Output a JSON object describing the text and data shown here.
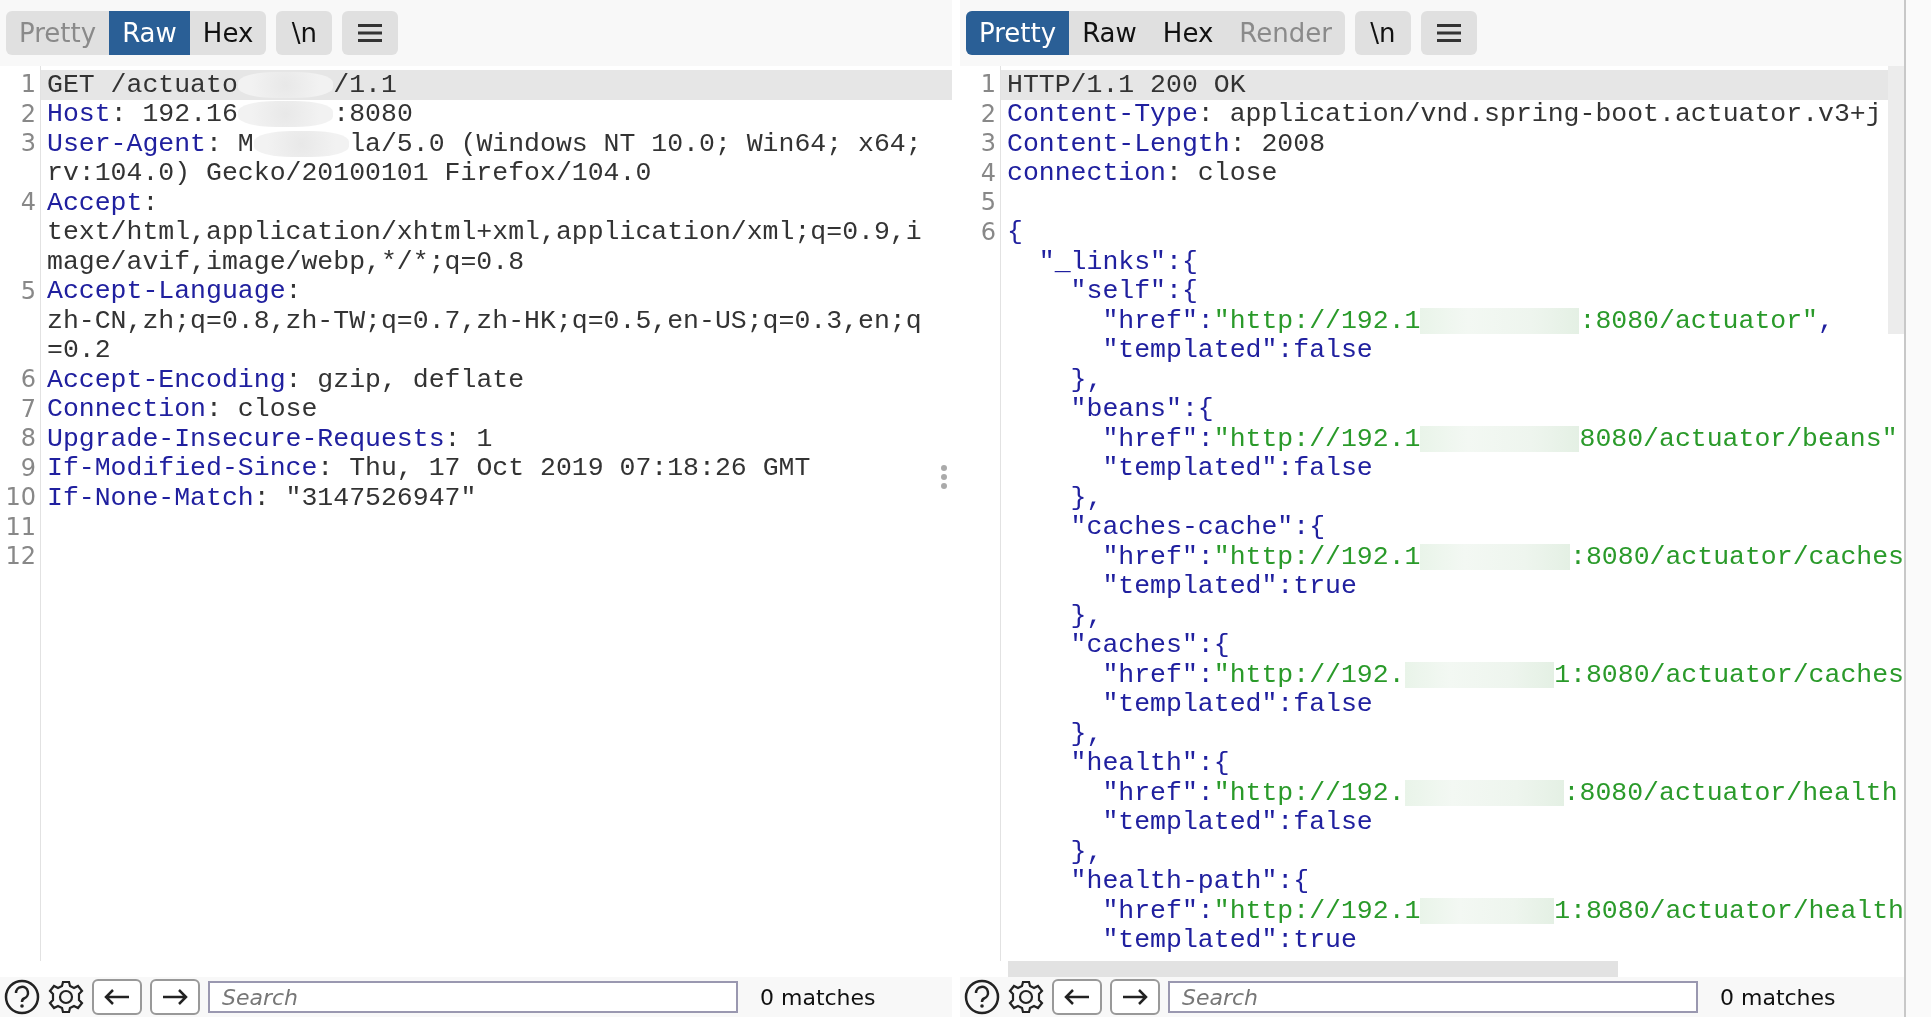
{
  "panes": [
    {
      "tabs": [
        {
          "label": "Pretty",
          "selected": false,
          "disabled": true
        },
        {
          "label": "Raw",
          "selected": true,
          "disabled": false
        },
        {
          "label": "Hex",
          "selected": false,
          "disabled": false
        }
      ],
      "newline_button": "\\n",
      "lines": [
        {
          "number": "1",
          "current": true,
          "rows": [
            [
              {
                "kind": "plain",
                "text": "GET /actuato"
              },
              {
                "kind": "mask"
              },
              {
                "kind": "plain",
                "text": "/1.1"
              }
            ]
          ]
        },
        {
          "number": "2",
          "current": false,
          "rows": [
            [
              {
                "kind": "key",
                "text": "Host"
              },
              {
                "kind": "plain",
                "text": ": 192.16"
              },
              {
                "kind": "mask"
              },
              {
                "kind": "plain",
                "text": ":8080"
              }
            ]
          ]
        },
        {
          "number": "3",
          "current": false,
          "rows": [
            [
              {
                "kind": "key",
                "text": "User-Agent"
              },
              {
                "kind": "plain",
                "text": ": M"
              },
              {
                "kind": "mask"
              },
              {
                "kind": "plain",
                "text": "la/5.0 (Windows NT 10.0; Win64; x64;"
              }
            ],
            [
              {
                "kind": "plain",
                "text": "rv:104.0) Gecko/20100101 Firefox/104.0"
              }
            ]
          ]
        },
        {
          "number": "4",
          "current": false,
          "rows": [
            [
              {
                "kind": "key",
                "text": "Accept"
              },
              {
                "kind": "plain",
                "text": ":"
              }
            ],
            [
              {
                "kind": "plain",
                "text": "text/html,application/xhtml+xml,application/xml;q=0.9,i"
              }
            ],
            [
              {
                "kind": "plain",
                "text": "mage/avif,image/webp,*/*;q=0.8"
              }
            ]
          ]
        },
        {
          "number": "5",
          "current": false,
          "rows": [
            [
              {
                "kind": "key",
                "text": "Accept-Language"
              },
              {
                "kind": "plain",
                "text": ":"
              }
            ],
            [
              {
                "kind": "plain",
                "text": "zh-CN,zh;q=0.8,zh-TW;q=0.7,zh-HK;q=0.5,en-US;q=0.3,en;q"
              }
            ],
            [
              {
                "kind": "plain",
                "text": "=0.2"
              }
            ]
          ]
        },
        {
          "number": "6",
          "current": false,
          "rows": [
            [
              {
                "kind": "key",
                "text": "Accept-Encoding"
              },
              {
                "kind": "plain",
                "text": ": gzip, deflate"
              }
            ]
          ]
        },
        {
          "number": "7",
          "current": false,
          "rows": [
            [
              {
                "kind": "key",
                "text": "Connection"
              },
              {
                "kind": "plain",
                "text": ": close"
              }
            ]
          ]
        },
        {
          "number": "8",
          "current": false,
          "rows": [
            [
              {
                "kind": "key",
                "text": "Upgrade-Insecure-Requests"
              },
              {
                "kind": "plain",
                "text": ": 1"
              }
            ]
          ]
        },
        {
          "number": "9",
          "current": false,
          "rows": [
            [
              {
                "kind": "key",
                "text": "If-Modified-Since"
              },
              {
                "kind": "plain",
                "text": ": Thu, 17 Oct 2019 07:18:26 GMT"
              }
            ]
          ]
        },
        {
          "number": "10",
          "current": false,
          "rows": [
            [
              {
                "kind": "key",
                "text": "If-None-Match"
              },
              {
                "kind": "plain",
                "text": ": \"3147526947\""
              }
            ]
          ]
        },
        {
          "number": "11",
          "current": false,
          "rows": [
            []
          ]
        },
        {
          "number": "12",
          "current": false,
          "rows": [
            []
          ]
        }
      ],
      "search": {
        "placeholder": "Search"
      },
      "matches": "0 matches"
    },
    {
      "tabs": [
        {
          "label": "Pretty",
          "selected": true,
          "disabled": false
        },
        {
          "label": "Raw",
          "selected": false,
          "disabled": false
        },
        {
          "label": "Hex",
          "selected": false,
          "disabled": false
        },
        {
          "label": "Render",
          "selected": false,
          "disabled": true
        }
      ],
      "newline_button": "\\n",
      "lines": [
        {
          "number": "1",
          "current": true,
          "rows": [
            [
              {
                "kind": "plain",
                "text": "HTTP/1.1 200 OK"
              }
            ]
          ]
        },
        {
          "number": "2",
          "current": false,
          "rows": [
            [
              {
                "kind": "key",
                "text": "Content-Type"
              },
              {
                "kind": "plain",
                "text": ": application/vnd.spring-boot.actuator.v3+j"
              }
            ]
          ]
        },
        {
          "number": "3",
          "current": false,
          "rows": [
            [
              {
                "kind": "key",
                "text": "Content-Length"
              },
              {
                "kind": "plain",
                "text": ": 2008"
              }
            ]
          ]
        },
        {
          "number": "4",
          "current": false,
          "rows": [
            [
              {
                "kind": "key",
                "text": "connection"
              },
              {
                "kind": "plain",
                "text": ": close"
              }
            ]
          ]
        },
        {
          "number": "5",
          "current": false,
          "rows": [
            []
          ]
        },
        {
          "number": "6",
          "current": false,
          "rows": [
            [
              {
                "kind": "key",
                "text": "{"
              }
            ],
            [
              {
                "kind": "key",
                "text": "  \"_links\":{"
              }
            ],
            [
              {
                "kind": "key",
                "text": "    \"self\":{"
              }
            ],
            [
              {
                "kind": "key",
                "text": "      \"href\":"
              },
              {
                "kind": "string",
                "text": "\"http://192.1"
              },
              {
                "kind": "mask"
              },
              {
                "kind": "string",
                "text": ":8080/actuator\""
              },
              {
                "kind": "key",
                "text": ","
              }
            ],
            [
              {
                "kind": "key",
                "text": "      \"templated\":false"
              }
            ],
            [
              {
                "kind": "key",
                "text": "    },"
              }
            ],
            [
              {
                "kind": "key",
                "text": "    \"beans\":{"
              }
            ],
            [
              {
                "kind": "key",
                "text": "      \"href\":"
              },
              {
                "kind": "string",
                "text": "\"http://192.1"
              },
              {
                "kind": "mask"
              },
              {
                "kind": "string",
                "text": "8080/actuator/beans\""
              }
            ],
            [
              {
                "kind": "key",
                "text": "      \"templated\":false"
              }
            ],
            [
              {
                "kind": "key",
                "text": "    },"
              }
            ],
            [
              {
                "kind": "key",
                "text": "    \"caches-cache\":{"
              }
            ],
            [
              {
                "kind": "key",
                "text": "      \"href\":"
              },
              {
                "kind": "string",
                "text": "\"http://192.1"
              },
              {
                "kind": "mask"
              },
              {
                "kind": "string",
                "text": ":8080/actuator/caches"
              }
            ],
            [
              {
                "kind": "key",
                "text": "      \"templated\":true"
              }
            ],
            [
              {
                "kind": "key",
                "text": "    },"
              }
            ],
            [
              {
                "kind": "key",
                "text": "    \"caches\":{"
              }
            ],
            [
              {
                "kind": "key",
                "text": "      \"href\":"
              },
              {
                "kind": "string",
                "text": "\"http://192."
              },
              {
                "kind": "mask"
              },
              {
                "kind": "string",
                "text": "1:8080/actuator/caches"
              }
            ],
            [
              {
                "kind": "key",
                "text": "      \"templated\":false"
              }
            ],
            [
              {
                "kind": "key",
                "text": "    },"
              }
            ],
            [
              {
                "kind": "key",
                "text": "    \"health\":{"
              }
            ],
            [
              {
                "kind": "key",
                "text": "      \"href\":"
              },
              {
                "kind": "string",
                "text": "\"http://192."
              },
              {
                "kind": "mask"
              },
              {
                "kind": "string",
                "text": ":8080/actuator/health"
              }
            ],
            [
              {
                "kind": "key",
                "text": "      \"templated\":false"
              }
            ],
            [
              {
                "kind": "key",
                "text": "    },"
              }
            ],
            [
              {
                "kind": "key",
                "text": "    \"health-path\":{"
              }
            ],
            [
              {
                "kind": "key",
                "text": "      \"href\":"
              },
              {
                "kind": "string",
                "text": "\"http://192.1"
              },
              {
                "kind": "mask"
              },
              {
                "kind": "string",
                "text": "1:8080/actuator/health"
              }
            ],
            [
              {
                "kind": "key",
                "text": "      \"templated\":true"
              }
            ]
          ]
        }
      ],
      "search": {
        "placeholder": "Search"
      },
      "matches": "0 matches"
    }
  ]
}
